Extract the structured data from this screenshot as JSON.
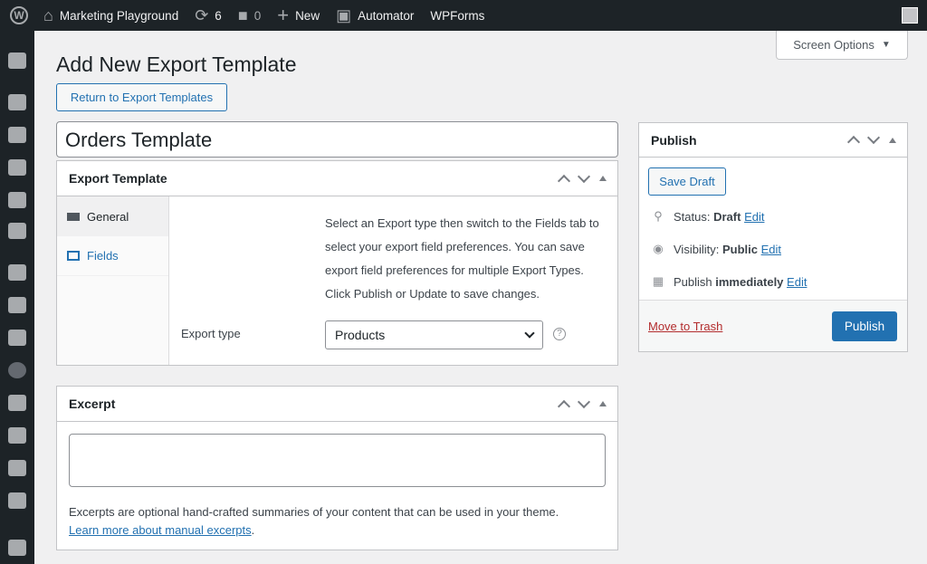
{
  "adminbar": {
    "site": "Marketing Playground",
    "updates": "6",
    "comments": "0",
    "new": "New",
    "automator": "Automator",
    "wpforms": "WPForms"
  },
  "sidebar": {
    "icons": [
      "dashboard-icon",
      "pin-icon",
      "media-icon",
      "pages-icon",
      "comments-icon",
      "automator-icon",
      "woocommerce-icon",
      "archive-icon",
      "ticket-icon",
      "export-icon",
      "money-icon",
      "chart-icon",
      "megaphone-icon",
      "form-icon",
      "brush-icon"
    ]
  },
  "screen_options": "Screen Options",
  "page_title": "Add New Export Template",
  "return_button": "Return to Export Templates",
  "title_value": "Orders Template",
  "export_box": {
    "title": "Export Template",
    "tabs": [
      {
        "label": "General",
        "active": true
      },
      {
        "label": "Fields",
        "active": false
      }
    ],
    "description": "Select an Export type then switch to the Fields tab to select your export field preferences. You can save export field preferences for multiple Export Types. Click Publish or Update to save changes.",
    "export_type_label": "Export type",
    "export_type_value": "Products"
  },
  "excerpt_box": {
    "title": "Excerpt",
    "textarea_value": "",
    "help": "Excerpts are optional hand-crafted summaries of your content that can be used in your theme.",
    "link": "Learn more about manual excerpts",
    "link_suffix": "."
  },
  "publish_box": {
    "title": "Publish",
    "save_draft": "Save Draft",
    "status_label": "Status:",
    "status_value": "Draft",
    "visibility_label": "Visibility:",
    "visibility_value": "Public",
    "publish_label": "Publish",
    "publish_value": "immediately",
    "edit": "Edit",
    "trash": "Move to Trash",
    "publish_button": "Publish"
  },
  "colors": {
    "accent": "#2271b1",
    "danger": "#b32d2e",
    "adminbar": "#1d2327"
  }
}
